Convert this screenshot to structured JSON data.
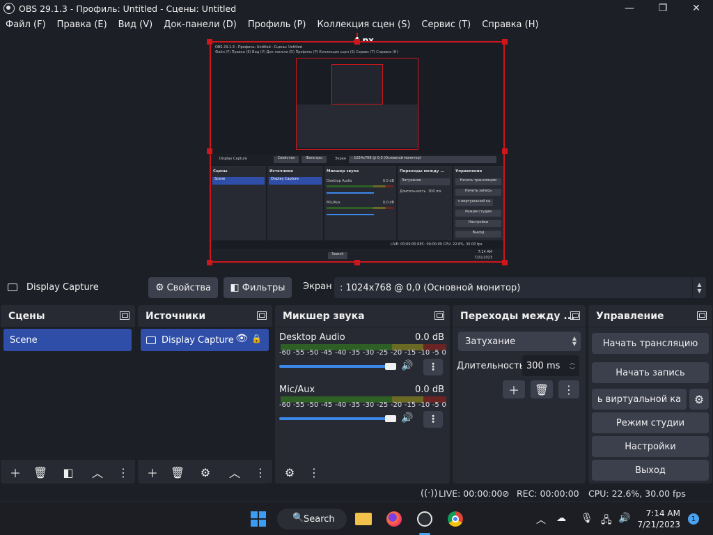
{
  "window": {
    "title": "OBS 29.1.3 - Профиль: Untitled - Сцены: Untitled",
    "minimize": "—",
    "maximize": "❐",
    "close": "✕"
  },
  "menu": [
    "Файл (F)",
    "Правка (E)",
    "Вид (V)",
    "Док-панели (D)",
    "Профиль (P)",
    "Коллекция сцен (S)",
    "Сервис (T)",
    "Справка (H)"
  ],
  "preview": {
    "distance_label": "4 px",
    "nested": {
      "title": "OBS 29.1.3 - Профиль: Untitled - Сцены: Untitled",
      "menu": "Файл (F)  Правка (E)  Вид (V)  Док-панели (D)  Профиль (P)  Коллекция сцен (S)  Сервис (T)  Справка (H)",
      "source_name": "Display Capture",
      "properties": "Свойства",
      "filters": "Фильтры",
      "screen_label": "Экран",
      "screen_value": ": 1024x768 @ 0,0 (Основной монитор)",
      "scenes": "Сцены",
      "sources": "Источники",
      "mixer": "Микшер звука",
      "transitions": "Переходы между ...",
      "controls": "Управление",
      "scene_item": "Scene",
      "source_item": "Display Capture",
      "desktop_audio": "Desktop Audio",
      "mic_aux": "Mic/Aux",
      "db": "0.0 dB",
      "fade": "Затухание",
      "duration": "Длительность",
      "duration_value": "300 ms",
      "start_stream": "Начать трансляцию",
      "start_record": "Начать запись",
      "virtual_cam": "с виртуальной ка",
      "studio_mode": "Режим студии",
      "settings": "Настройки",
      "exit": "Выход",
      "status": "LIVE: 00:00:00   REC: 00:00:00     CPU: 22.6%, 30.00 fps",
      "search": "Search",
      "clock_time": "7:14 AM",
      "clock_date": "7/21/2023"
    }
  },
  "source_toolbar": {
    "source_name": "Display Capture",
    "properties_label": "Свойства",
    "filters_label": "Фильтры",
    "screen_label": "Экран",
    "screen_value": ": 1024x768 @ 0,0 (Основной монитор)"
  },
  "docks": {
    "scenes": {
      "title": "Сцены",
      "items": [
        "Scene"
      ]
    },
    "sources": {
      "title": "Источники",
      "items": [
        "Display Capture"
      ]
    },
    "mixer": {
      "title": "Микшер звука",
      "ticks": [
        "-60",
        "-55",
        "-50",
        "-45",
        "-40",
        "-35",
        "-30",
        "-25",
        "-20",
        "-15",
        "-10",
        "-5",
        "0"
      ],
      "channels": [
        {
          "name": "Desktop Audio",
          "db": "0.0 dB",
          "volume_percent": 100
        },
        {
          "name": "Mic/Aux",
          "db": "0.0 dB",
          "volume_percent": 100
        }
      ]
    },
    "transitions": {
      "title": "Переходы между ...",
      "selected": "Затухание",
      "duration_label": "Длительность",
      "duration_value": "300 ms"
    },
    "controls": {
      "title": "Управление",
      "start_stream": "Начать трансляцию",
      "start_record": "Начать запись",
      "virtual_cam": "ь виртуальной ка",
      "studio_mode": "Режим студии",
      "settings": "Настройки",
      "exit": "Выход"
    }
  },
  "status": {
    "live": "LIVE: 00:00:00",
    "rec": "REC: 00:00:00",
    "cpu": "CPU: 22.6%, 30.00 fps"
  },
  "taskbar": {
    "search_label": "Search",
    "time": "7:14 AM",
    "date": "7/21/2023",
    "notifications": "1"
  },
  "colors": {
    "accent": "#2f4ea8",
    "selection_border": "#d0161c",
    "slider": "#3b88ea"
  }
}
